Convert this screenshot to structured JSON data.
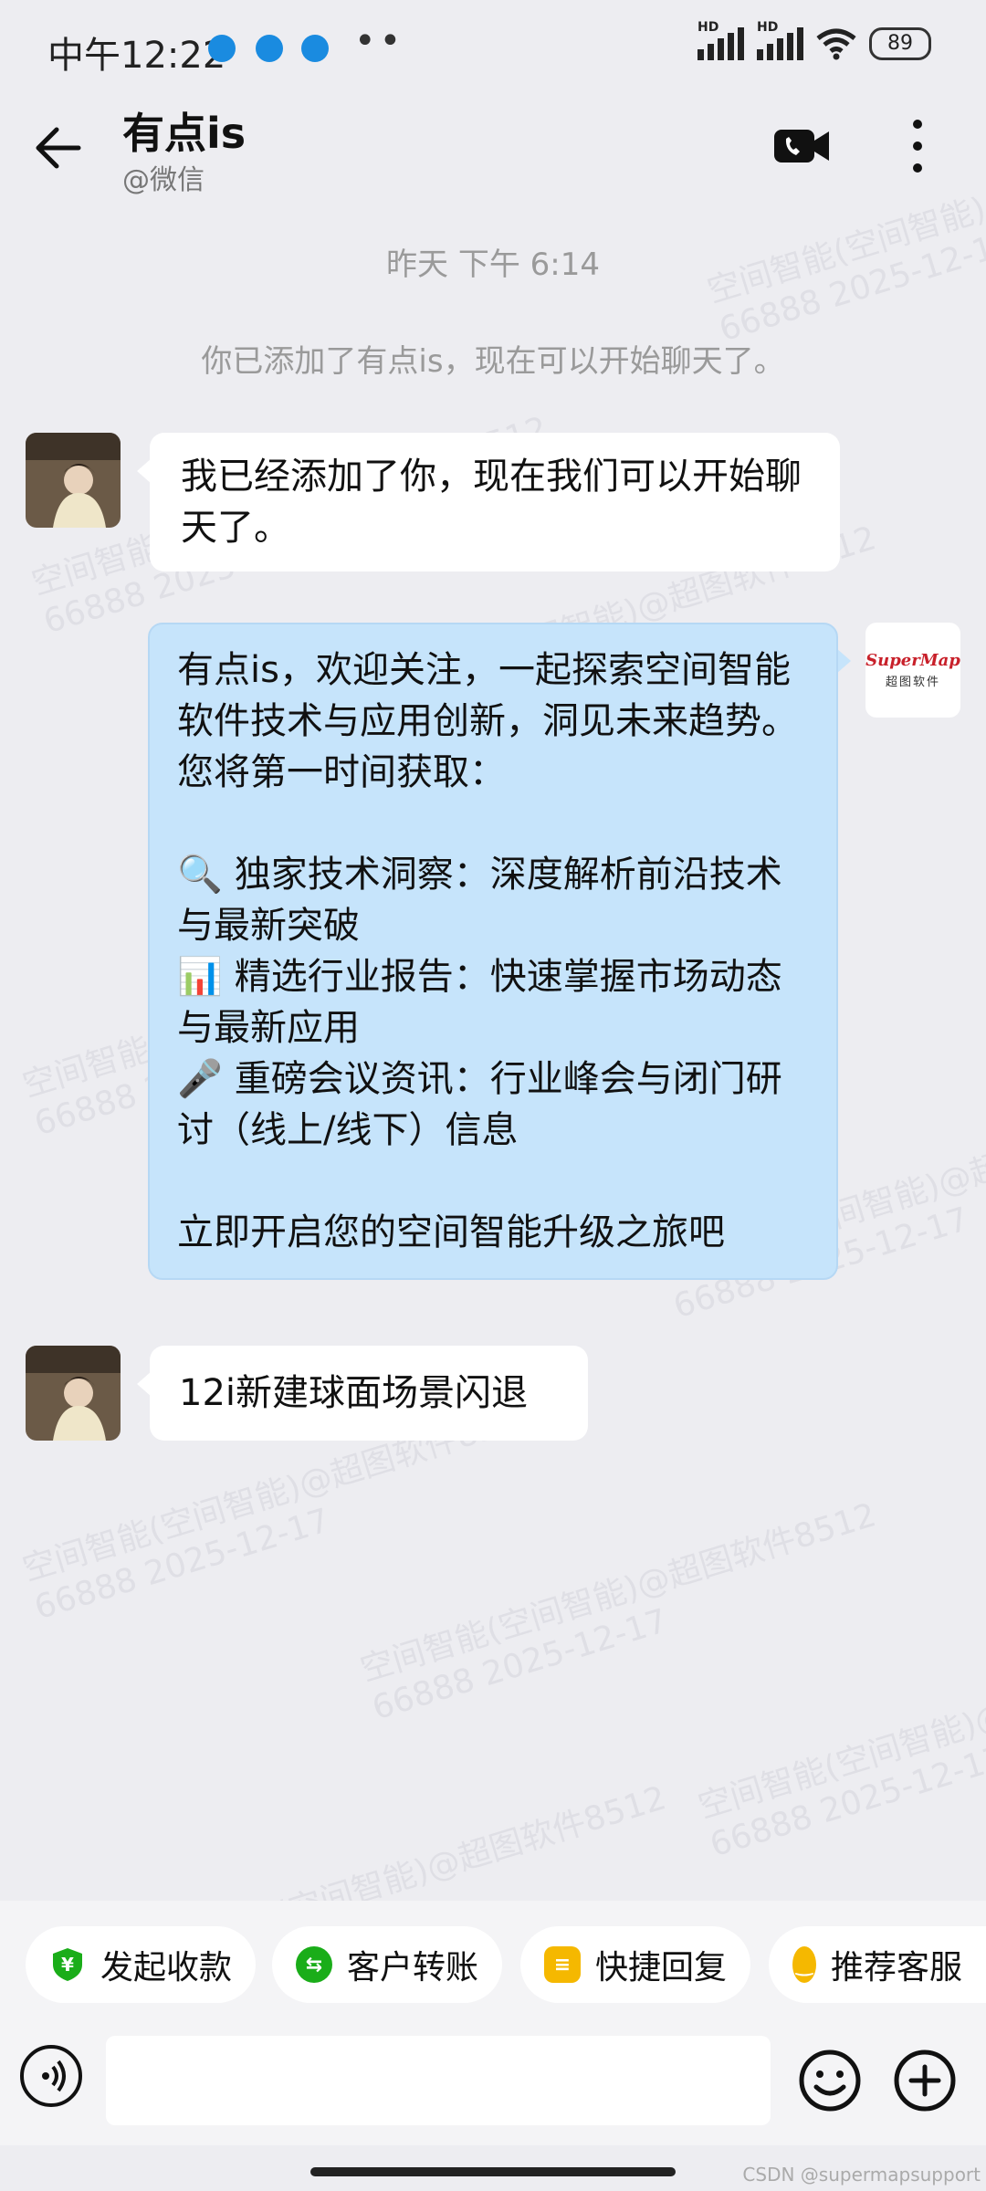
{
  "status_bar": {
    "time": "中午12:22",
    "battery": "89",
    "network_labels": [
      "HD",
      "HD"
    ]
  },
  "header": {
    "title": "有点is",
    "subtitle": "@微信",
    "icons": [
      "back-arrow-icon",
      "video-call-icon",
      "more-vertical-icon"
    ]
  },
  "chat": {
    "time_label": "昨天  下午 6:14",
    "system_message": "你已添加了有点is，现在可以开始聊天了。",
    "messages": [
      {
        "side": "left",
        "text": "我已经添加了你，现在我们可以开始聊天了。"
      },
      {
        "side": "right",
        "avatar_text": [
          "SuperMap",
          "超图软件"
        ],
        "intro": "有点is，欢迎关注，一起探索空间智能软件技术与应用创新，洞见未来趋势。您将第一时间获取：",
        "items": [
          {
            "icon": "🔍",
            "text": "独家技术洞察：深度解析前沿技术与最新突破"
          },
          {
            "icon": "📊",
            "text": "精选行业报告：快速掌握市场动态与最新应用"
          },
          {
            "icon": "🎤",
            "text": "重磅会议资讯：行业峰会与闭门研讨（线上/线下）信息"
          }
        ],
        "outro": "立即开启您的空间智能升级之旅吧"
      },
      {
        "side": "left",
        "text": "12i新建球面场景闪退"
      }
    ]
  },
  "watermarks": [
    "空间智能(空间智能)@超图软件8512",
    "66888 2025-12-17"
  ],
  "quick_actions": [
    {
      "label": "发起收款",
      "icon": "payment-shield-icon",
      "color": "#1aad19"
    },
    {
      "label": "客户转账",
      "icon": "transfer-icon",
      "color": "#1aad19"
    },
    {
      "label": "快捷回复",
      "icon": "quick-reply-icon",
      "color": "#f5b800"
    },
    {
      "label": "推荐客服",
      "icon": "recommend-service-icon",
      "color": "#f5b800"
    }
  ],
  "input": {
    "placeholder": "",
    "icons": [
      "voice-icon",
      "emoji-icon",
      "plus-icon"
    ]
  },
  "footer_credit": "CSDN @supermapsupport"
}
